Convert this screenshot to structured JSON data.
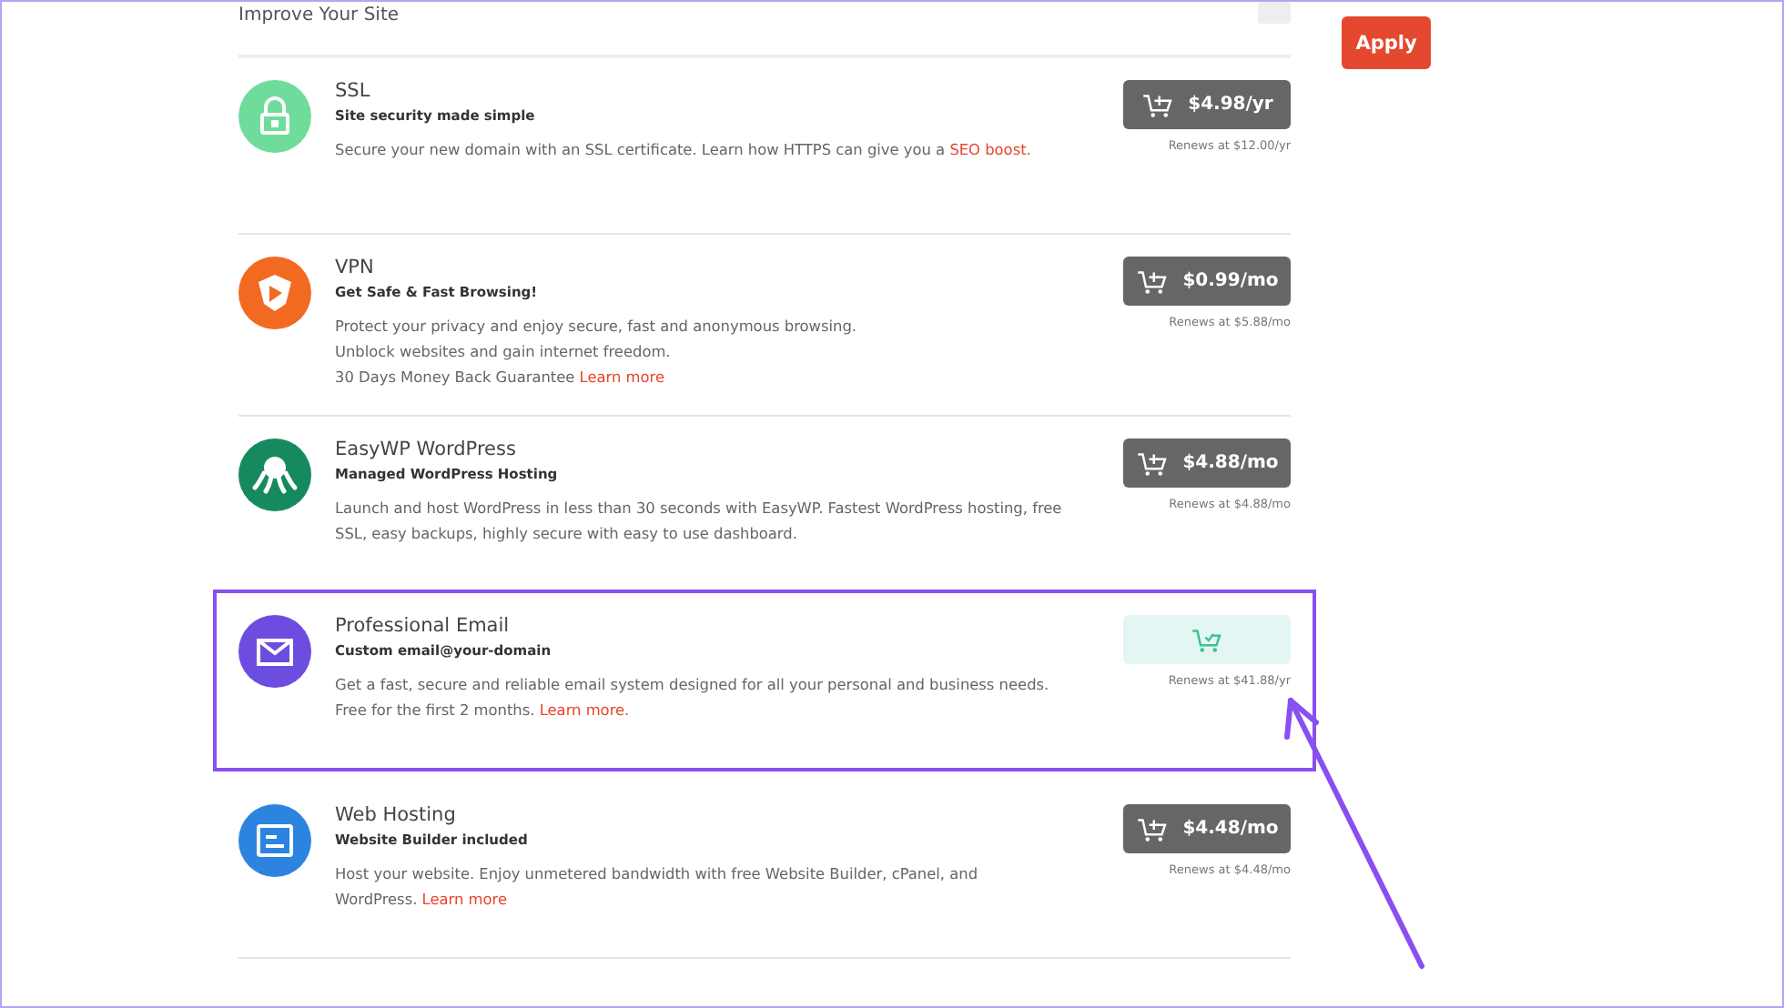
{
  "section": {
    "title": "Improve Your Site",
    "apply_button": "Apply"
  },
  "products": [
    {
      "name": "SSL",
      "tagline": "Site security made simple",
      "color": "#6fdc9c",
      "in_cart": false,
      "highlighted": false,
      "price": "$4.98/yr",
      "renewal": "Renews at $12.00/yr",
      "paragraphs": [
        {
          "text": "Secure your new domain with an SSL certificate. Learn how HTTPS can give you a",
          "link": "SEO boost."
        }
      ]
    },
    {
      "name": "VPN",
      "tagline": "Get Safe & Fast Browsing!",
      "color": "#f26a21",
      "in_cart": false,
      "highlighted": false,
      "price": "$0.99/mo",
      "renewal": "Renews at $5.88/mo",
      "paragraphs": [
        {
          "text": "Protect your privacy and enjoy secure, fast and anonymous browsing."
        },
        {
          "text": "Unblock websites and gain internet freedom."
        },
        {
          "text": "30 Days Money Back Guarantee",
          "link": "Learn more"
        }
      ]
    },
    {
      "name": "EasyWP WordPress",
      "tagline": "Managed WordPress Hosting",
      "color": "#168a5e",
      "in_cart": false,
      "highlighted": false,
      "price": "$4.88/mo",
      "renewal": "Renews at $4.88/mo",
      "paragraphs": [
        {
          "text": "Launch and host WordPress in less than 30 seconds with EasyWP. Fastest WordPress hosting, free SSL, easy backups, highly secure with easy to use dashboard."
        }
      ]
    },
    {
      "name": "Professional Email",
      "tagline": "Custom email@your-domain",
      "color": "#6c4de0",
      "in_cart": true,
      "highlighted": true,
      "renewal": "Renews at $41.88/yr",
      "paragraphs": [
        {
          "text": "Get a fast, secure and reliable email system designed for all your personal and business needs."
        },
        {
          "text": "Free for the first 2 months.",
          "link": "Learn more."
        }
      ]
    },
    {
      "name": "Web Hosting",
      "tagline": "Website Builder included",
      "color": "#2d84e0",
      "in_cart": false,
      "highlighted": false,
      "price": "$4.48/mo",
      "renewal": "Renews at $4.48/mo",
      "paragraphs": [
        {
          "text": "Host your website. Enjoy unmetered bandwidth with free Website Builder, cPanel, and WordPress.",
          "link": "Learn more"
        }
      ]
    }
  ]
}
